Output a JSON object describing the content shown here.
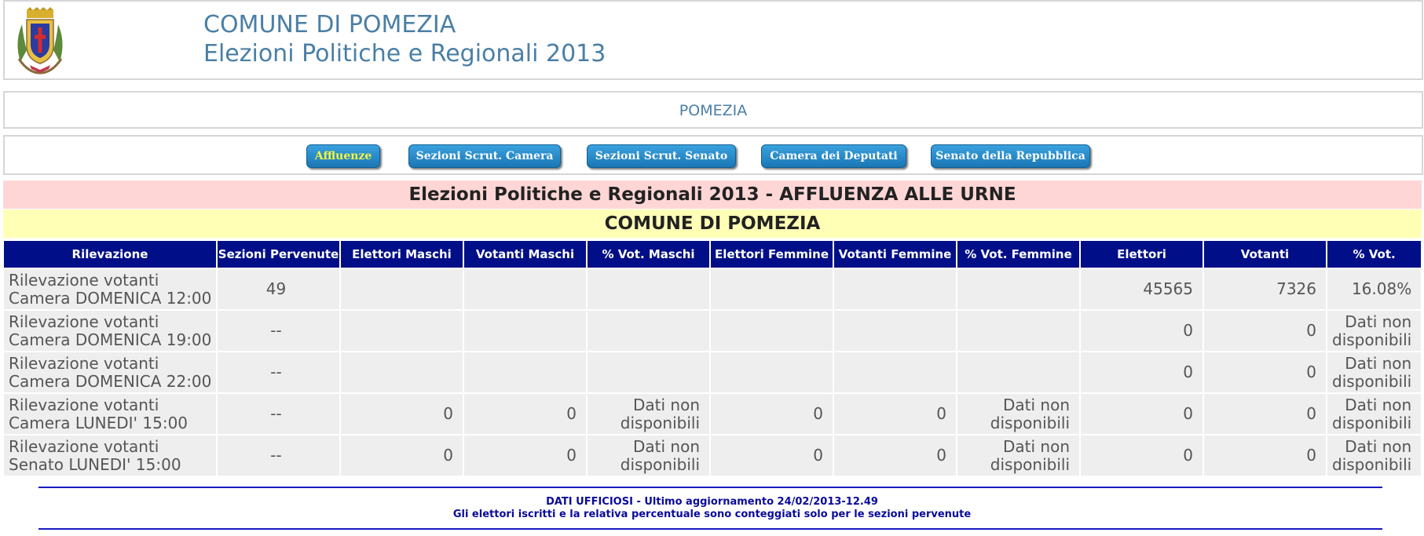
{
  "header": {
    "line1": "COMUNE DI POMEZIA",
    "line2": "Elezioni Politiche e Regionali 2013",
    "logo_icon": "coat-of-arms-icon"
  },
  "city_band": "POMEZIA",
  "nav": [
    {
      "label": "Affluenze",
      "active": true
    },
    {
      "label": "Sezioni Scrut. Camera",
      "active": false
    },
    {
      "label": "Sezioni Scrut. Senato",
      "active": false
    },
    {
      "label": "Camera dei Deputati",
      "active": false
    },
    {
      "label": "Senato della Repubblica",
      "active": false
    }
  ],
  "colors": {
    "nav_active": "#f5f540",
    "table_header": "#000f87",
    "heading_pink": "#ffd6d6",
    "heading_yellow": "#ffffb6"
  },
  "section_title": "Elezioni Politiche e Regionali 2013 - AFFLUENZA ALLE URNE",
  "section_subtitle": "COMUNE DI POMEZIA",
  "table": {
    "columns": [
      "Rilevazione",
      "Sezioni Pervenute",
      "Elettori Maschi",
      "Votanti Maschi",
      "% Vot. Maschi",
      "Elettori Femmine",
      "Votanti Femmine",
      "% Vot. Femmine",
      "Elettori",
      "Votanti",
      "% Vot."
    ],
    "rows": [
      {
        "rilevazione_1": "Rilevazione votanti",
        "rilevazione_2": "Camera DOMENICA 12:00",
        "sezioni": "49",
        "elettori_m": "",
        "votanti_m": "",
        "pct_m_1": "",
        "pct_m_2": "",
        "elettori_f": "",
        "votanti_f": "",
        "pct_f_1": "",
        "pct_f_2": "",
        "elettori": "45565",
        "votanti": "7326",
        "pct_1": "16.08%",
        "pct_2": ""
      },
      {
        "rilevazione_1": "Rilevazione votanti",
        "rilevazione_2": "Camera DOMENICA 19:00",
        "sezioni": "--",
        "elettori_m": "",
        "votanti_m": "",
        "pct_m_1": "",
        "pct_m_2": "",
        "elettori_f": "",
        "votanti_f": "",
        "pct_f_1": "",
        "pct_f_2": "",
        "elettori": "0",
        "votanti": "0",
        "pct_1": "Dati non",
        "pct_2": "disponibili"
      },
      {
        "rilevazione_1": "Rilevazione votanti",
        "rilevazione_2": "Camera DOMENICA 22:00",
        "sezioni": "--",
        "elettori_m": "",
        "votanti_m": "",
        "pct_m_1": "",
        "pct_m_2": "",
        "elettori_f": "",
        "votanti_f": "",
        "pct_f_1": "",
        "pct_f_2": "",
        "elettori": "0",
        "votanti": "0",
        "pct_1": "Dati non",
        "pct_2": "disponibili"
      },
      {
        "rilevazione_1": "Rilevazione votanti",
        "rilevazione_2": "Camera LUNEDI' 15:00",
        "sezioni": "--",
        "elettori_m": "0",
        "votanti_m": "0",
        "pct_m_1": "Dati non",
        "pct_m_2": "disponibili",
        "elettori_f": "0",
        "votanti_f": "0",
        "pct_f_1": "Dati non",
        "pct_f_2": "disponibili",
        "elettori": "0",
        "votanti": "0",
        "pct_1": "Dati non",
        "pct_2": "disponibili"
      },
      {
        "rilevazione_1": "Rilevazione votanti",
        "rilevazione_2": "Senato LUNEDI' 15:00",
        "sezioni": "--",
        "elettori_m": "0",
        "votanti_m": "0",
        "pct_m_1": "Dati non",
        "pct_m_2": "disponibili",
        "elettori_f": "0",
        "votanti_f": "0",
        "pct_f_1": "Dati non",
        "pct_f_2": "disponibili",
        "elettori": "0",
        "votanti": "0",
        "pct_1": "Dati non",
        "pct_2": "disponibili"
      }
    ]
  },
  "footer": {
    "line1": "DATI UFFICIOSI - Ultimo aggiornamento 24/02/2013-12.49",
    "line2": "Gli elettori iscritti e la relativa percentuale sono conteggiati solo per le sezioni pervenute"
  }
}
